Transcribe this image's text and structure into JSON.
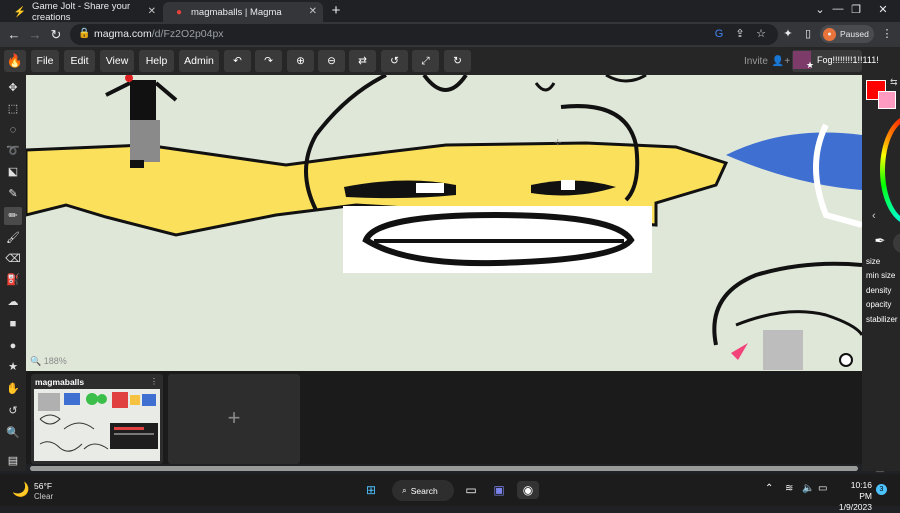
{
  "browser": {
    "tabs": [
      {
        "title": "Game Jolt - Share your creations",
        "icon": "gamejolt-icon"
      },
      {
        "title": "magmaballs | Magma",
        "icon": "magma-icon"
      }
    ],
    "url_host": "magma.com",
    "url_path": "/d/Fz2O2p04px",
    "profile_status": "Paused"
  },
  "app": {
    "menu": [
      "File",
      "Edit",
      "View",
      "Help",
      "Admin"
    ],
    "invite_label": "Invite",
    "username": "Fog!!!!!!!!1!!111!",
    "zoom_label": "188%",
    "brush_props": [
      "size",
      "min size",
      "density",
      "opacity",
      "stabilizer"
    ],
    "layer_name": "magmaballs",
    "add_layer_label": "+",
    "colors": {
      "primary": "#ff0000",
      "secondary": "#ff9ac0"
    }
  },
  "taskbar": {
    "weather_temp": "56°F",
    "weather_cond": "Clear",
    "search_label": "Search",
    "time": "10:16 PM",
    "date": "1/9/2023",
    "notification_count": "3"
  }
}
